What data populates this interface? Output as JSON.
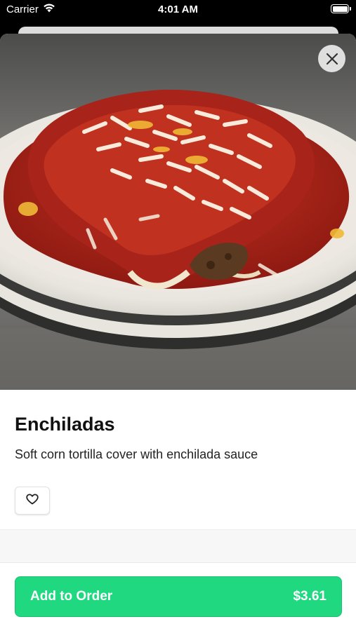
{
  "status_bar": {
    "carrier": "Carrier",
    "time": "4:01 AM"
  },
  "item": {
    "name": "Enchiladas",
    "description": "Soft corn tortilla cover with enchilada sauce",
    "image_subject": "enchiladas-photo"
  },
  "actions": {
    "add_label": "Add to Order",
    "price": "$3.61"
  },
  "colors": {
    "accent": "#1fd87f",
    "sauce": "#b3261c"
  },
  "icons": {
    "close": "close-icon",
    "favorite": "heart-icon",
    "wifi": "wifi-icon",
    "battery": "battery-icon"
  }
}
